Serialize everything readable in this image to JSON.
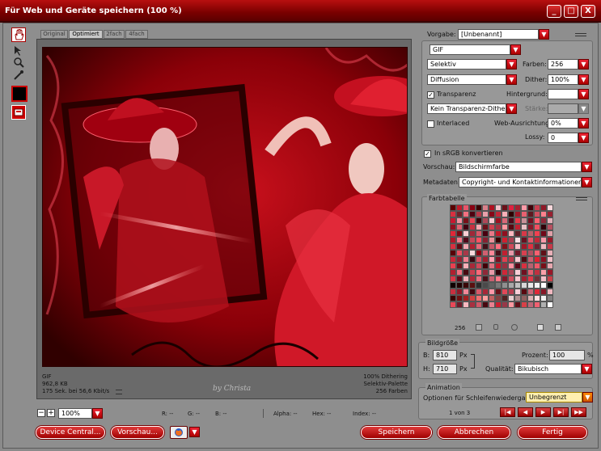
{
  "window": {
    "title": "Für Web und Geräte speichern (100 %)",
    "buttons": [
      "_",
      "□",
      "X"
    ]
  },
  "view_tabs": [
    "Original",
    "Optimiert",
    "2fach",
    "4fach"
  ],
  "preview_info": {
    "left": [
      "GIF",
      "962,8 KB",
      "175 Sek. bei 56,6 Kbit/s"
    ],
    "right": [
      "100% Dithering",
      "Selektiv-Palette",
      "256 Farben"
    ],
    "watermark": "by Christa"
  },
  "status_bar": {
    "zoom": "100%",
    "r": "R: --",
    "g": "G: --",
    "b": "B: --",
    "alpha": "Alpha: --",
    "hex": "Hex: --",
    "index": "Index: --"
  },
  "settings": {
    "preset_label": "Vorgabe:",
    "preset_value": "[Unbenannt]",
    "format": "GIF",
    "reduction": "Selektiv",
    "colors_label": "Farben:",
    "colors_value": "256",
    "dither_algo": "Diffusion",
    "dither_label": "Dither:",
    "dither_value": "100%",
    "transparency_label": "Transparenz",
    "matte_label": "Hintergrund:",
    "transparency_dither": "Kein Transparenz-Dither",
    "amount_label": "Stärke:",
    "interlaced_label": "Interlaced",
    "web_snap_label": "Web-Ausrichtung:",
    "web_snap_value": "0%",
    "lossy_label": "Lossy:",
    "lossy_value": "0",
    "srgb_label": "In sRGB konvertieren",
    "preview_label": "Vorschau:",
    "preview_value": "Bildschirmfarbe",
    "metadata_label": "Metadaten:",
    "metadata_value": "Copyright- und Kontaktinformationen"
  },
  "color_table": {
    "title": "Farbtabelle",
    "count": "256",
    "colors": [
      "#5a0000",
      "#c01a2a",
      "#e8556a",
      "#8a0012",
      "#3a0000",
      "#d8808a",
      "#b01020",
      "#f0c0c8",
      "#6a1018",
      "#e02040",
      "#a82030",
      "#ff9aa8",
      "#400008",
      "#c84050",
      "#901828",
      "#f8d8dc",
      "#d83040",
      "#702028",
      "#f27080",
      "#500010",
      "#b83848",
      "#e8a0aa",
      "#880818",
      "#c02838",
      "#f8b0b8",
      "#300000",
      "#a01828",
      "#e86070",
      "#601820",
      "#d05060",
      "#ff808c",
      "#982030",
      "#c81830",
      "#f090a0",
      "#781018",
      "#e84858",
      "#380008",
      "#b04858",
      "#f8c8d0",
      "#a01020",
      "#d86878",
      "#500818",
      "#e83848",
      "#c89098",
      "#701020",
      "#ff6070",
      "#902838",
      "#e0b0b8",
      "#901020",
      "#e06070",
      "#400010",
      "#c83040",
      "#f8a8b0",
      "#681018",
      "#d04050",
      "#a83040",
      "#ff98a0",
      "#580810",
      "#c02030",
      "#e8c0c4",
      "#881828",
      "#f05060",
      "#300008",
      "#b85060",
      "#e02838",
      "#780810",
      "#f8d0d4",
      "#a02838",
      "#d85868",
      "#480010",
      "#e87888",
      "#c01828",
      "#901020",
      "#ffb8c0",
      "#602028",
      "#d83848",
      "#b86068",
      "#f04050",
      "#700818",
      "#e0a0a8",
      "#b01828",
      "#f07888",
      "#500818",
      "#c84858",
      "#ff5060",
      "#882030",
      "#e89098",
      "#380000",
      "#d02030",
      "#a84050",
      "#f8e0e4",
      "#681020",
      "#e05868",
      "#c02838",
      "#f898a8",
      "#981828",
      "#d83040",
      "#600810",
      "#f0a8b0",
      "#b02030",
      "#e86878",
      "#401018",
      "#c85868",
      "#ff7080",
      "#801018",
      "#d04858",
      "#f8c0c8",
      "#a01828",
      "#e03040",
      "#702030",
      "#f0b8c0",
      "#c83848",
      "#580008",
      "#e85060",
      "#a83848",
      "#f8d8dc",
      "#880010",
      "#d06070",
      "#ff8898",
      "#481018",
      "#c02030",
      "#e898a8",
      "#701828",
      "#d84050",
      "#b05060",
      "#f86070",
      "#601018",
      "#e8b0b8",
      "#c82838",
      "#902030",
      "#f08090",
      "#380810",
      "#d85060",
      "#a02030",
      "#ffa0b0",
      "#781020",
      "#e04050",
      "#b83848",
      "#f8c8d0",
      "#500810",
      "#c86070",
      "#e02030",
      "#881020",
      "#f0c0c8",
      "#e84050",
      "#681018",
      "#f8b0b8",
      "#a82838",
      "#d04858",
      "#400008",
      "#e07080",
      "#c01828",
      "#983040",
      "#ff90a0",
      "#580818",
      "#d83040",
      "#b86070",
      "#f05868",
      "#781018",
      "#e8a8b0",
      "#b02030",
      "#f07080",
      "#480810",
      "#c84050",
      "#ff6878",
      "#902838",
      "#e89aa8",
      "#300008",
      "#d02838",
      "#a84858",
      "#f8d0d8",
      "#701020",
      "#e06070",
      "#c03040",
      "#f8a0a8",
      "#981828",
      "#d83848",
      "#600818",
      "#f0b0b8",
      "#b02838",
      "#e87080",
      "#481018",
      "#c86070",
      "#ff7888",
      "#801828",
      "#d05060",
      "#f8c8d0",
      "#a02030",
      "#e03848",
      "#703038",
      "#f0c0c8",
      "#c84048",
      "#100000",
      "#200000",
      "#3a0808",
      "#5a1010",
      "#2a2a2a",
      "#4a4a4a",
      "#606060",
      "#787878",
      "#909090",
      "#a8a8a8",
      "#c0c0c0",
      "#d8d8d8",
      "#e8e8e8",
      "#f4f4f4",
      "#ffffff",
      "#000000",
      "#c83040",
      "#901828",
      "#f08898",
      "#400810",
      "#d85868",
      "#a82838",
      "#ff98a8",
      "#681018",
      "#e04858",
      "#b84050",
      "#f8d0d8",
      "#580810",
      "#c86878",
      "#e02838",
      "#881828",
      "#f0b8c0",
      "#3a0000",
      "#701010",
      "#a02020",
      "#d04040",
      "#f07070",
      "#ffa0a0",
      "#c06060",
      "#804040",
      "#502020",
      "#e8d0d0",
      "#b09090",
      "#906060",
      "#d8b0b0",
      "#ffe0e0",
      "#f0f0f0",
      "#808080",
      "#e84858",
      "#701828",
      "#f8b8c0",
      "#a83040",
      "#d05868",
      "#480810",
      "#e88090",
      "#c82030",
      "#983848",
      "#ff98a0",
      "#601018",
      "#d84048",
      "#bb6878",
      "#f06070",
      "#b0b0b0",
      "#ffffff"
    ],
    "footer_icons": [
      "web-shift-icon",
      "lock-icon",
      "web-safe-icon",
      "new-color-icon",
      "delete-color-icon"
    ]
  },
  "image_size": {
    "title": "Bildgröße",
    "w_label": "B:",
    "w_value": "810",
    "h_label": "H:",
    "h_value": "710",
    "unit": "Px",
    "percent_label": "Prozent:",
    "percent_value": "100",
    "percent_unit": "%",
    "quality_label": "Qualität:",
    "quality_value": "Bikubisch"
  },
  "animation": {
    "title": "Animation",
    "loop_label": "Optionen für Schleifenwiedergabe:",
    "loop_value": "Unbegrenzt",
    "frame": "1 von 3"
  },
  "footer": {
    "device_central": "Device Central...",
    "preview": "Vorschau...",
    "save": "Speichern",
    "cancel": "Abbrechen",
    "done": "Fertig"
  }
}
